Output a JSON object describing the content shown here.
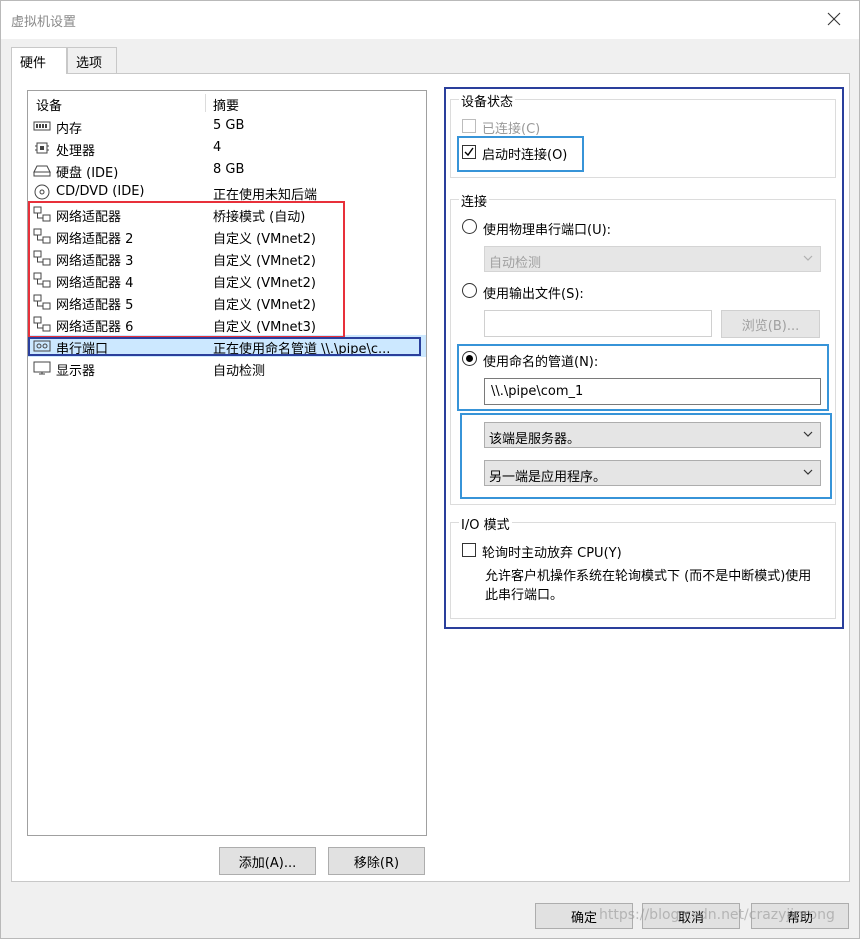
{
  "window": {
    "title": "虚拟机设置"
  },
  "tabs": [
    {
      "label": "硬件",
      "active": true
    },
    {
      "label": "选项",
      "active": false
    }
  ],
  "device_list": {
    "columns": {
      "device": "设备",
      "summary": "摘要"
    },
    "rows": [
      {
        "icon": "memory-icon",
        "name": "内存",
        "summary": "5 GB"
      },
      {
        "icon": "processor-icon",
        "name": "处理器",
        "summary": "4"
      },
      {
        "icon": "hard-disk-icon",
        "name": "硬盘 (IDE)",
        "summary": "8 GB"
      },
      {
        "icon": "cd-dvd-icon",
        "name": "CD/DVD (IDE)",
        "summary": "正在使用未知后端"
      },
      {
        "icon": "network-adapter-icon",
        "name": "网络适配器",
        "summary": "桥接模式 (自动)"
      },
      {
        "icon": "network-adapter-icon",
        "name": "网络适配器 2",
        "summary": "自定义 (VMnet2)"
      },
      {
        "icon": "network-adapter-icon",
        "name": "网络适配器 3",
        "summary": "自定义 (VMnet2)"
      },
      {
        "icon": "network-adapter-icon",
        "name": "网络适配器 4",
        "summary": "自定义 (VMnet2)"
      },
      {
        "icon": "network-adapter-icon",
        "name": "网络适配器 5",
        "summary": "自定义 (VMnet2)"
      },
      {
        "icon": "network-adapter-icon",
        "name": "网络适配器 6",
        "summary": "自定义 (VMnet3)"
      },
      {
        "icon": "serial-port-icon",
        "name": "串行端口",
        "summary": "正在使用命名管道 \\\\.\\pipe\\c...",
        "selected": true
      },
      {
        "icon": "display-icon",
        "name": "显示器",
        "summary": "自动检测"
      }
    ],
    "add_button": "添加(A)...",
    "remove_button": "移除(R)"
  },
  "device_status": {
    "label": "设备状态",
    "connected": {
      "label": "已连接(C)",
      "checked": false,
      "disabled": true
    },
    "connect_at_power_on": {
      "label": "启动时连接(O)",
      "checked": true
    }
  },
  "connection": {
    "label": "连接",
    "physical_port": {
      "label": "使用物理串行端口(U):",
      "selected": false,
      "value": "自动检测"
    },
    "output_file": {
      "label": "使用输出文件(S):",
      "selected": false,
      "value": "",
      "browse": "浏览(B)..."
    },
    "named_pipe": {
      "label": "使用命名的管道(N):",
      "selected": true,
      "value": "\\\\.\\pipe\\com_1"
    },
    "this_end": "该端是服务器。",
    "other_end": "另一端是应用程序。"
  },
  "io_mode": {
    "label": "I/O 模式",
    "yield_cpu": {
      "label": "轮询时主动放弃 CPU(Y)",
      "checked": false
    },
    "description": "允许客户机操作系统在轮询模式下 (而不是中断模式)使用此串行端口。"
  },
  "footer": {
    "ok": "确定",
    "cancel": "取消",
    "help": "帮助"
  },
  "watermark": "https://blog.csdn.net/crazyjinrong",
  "colors": {
    "highlight_red": "#e8303a",
    "highlight_navy": "#2a3f9c",
    "highlight_blue": "#3794d8",
    "selection": "#cce8ff"
  }
}
